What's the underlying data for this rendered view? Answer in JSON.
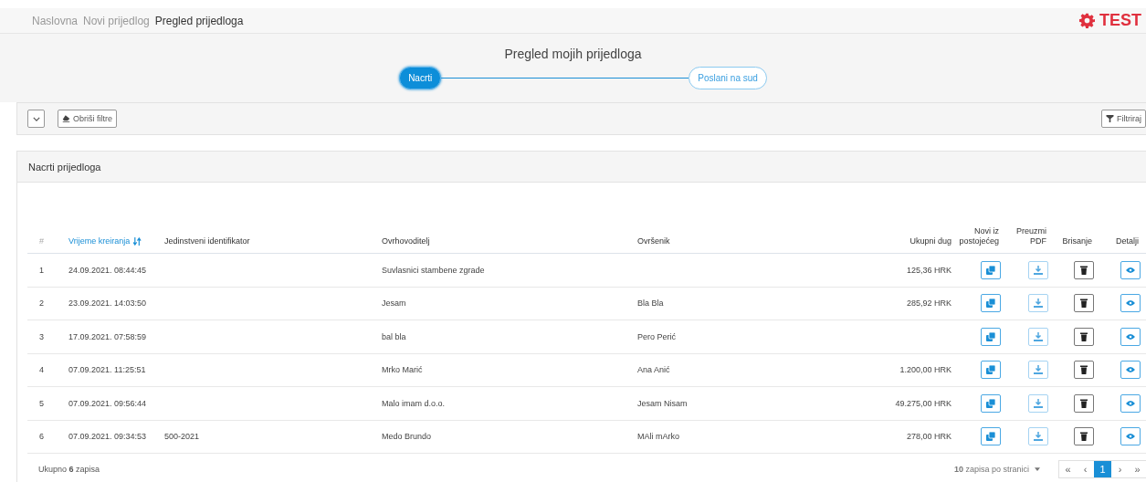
{
  "breadcrumbs": [
    {
      "label": "Naslovna",
      "selected": false
    },
    {
      "label": "Novi prijedlog",
      "selected": false
    },
    {
      "label": "Pregled prijedloga",
      "selected": true
    }
  ],
  "env_badge": "TEST",
  "page_title": "Pregled mojih prijedloga",
  "steps": [
    {
      "label": "Nacrti",
      "selected": true
    },
    {
      "label": "Poslani na sud",
      "selected": false
    }
  ],
  "filter_bar": {
    "clear_button": "Obriši filtre",
    "filter_button": "Filtriraj"
  },
  "card_title": "Nacrti prijedloga",
  "table": {
    "columns": [
      {
        "label": "#",
        "sortable": false
      },
      {
        "label": "Vrijeme kreiranja",
        "sortable": true
      },
      {
        "label": "Jedinstveni identifikator",
        "sortable": false
      },
      {
        "label": "Ovrhovoditelj",
        "sortable": false
      },
      {
        "label": "Ovršenik",
        "sortable": false
      },
      {
        "label": "Ukupni dug",
        "sortable": false
      },
      {
        "label": "Novi iz postojećeg",
        "sortable": false
      },
      {
        "label": "Preuzmi PDF",
        "sortable": false
      },
      {
        "label": "Brisanje",
        "sortable": false
      },
      {
        "label": "Detalji",
        "sortable": false
      }
    ],
    "rows": [
      {
        "num": "1",
        "created": "24.09.2021. 08:44:45",
        "identifier": "",
        "creditor": "Suvlasnici stambene zgrade",
        "debtor": "",
        "debt": "125,36 HRK"
      },
      {
        "num": "2",
        "created": "23.09.2021. 14:03:50",
        "identifier": "",
        "creditor": "Jesam",
        "debtor": "Bla Bla",
        "debt": "285,92 HRK"
      },
      {
        "num": "3",
        "created": "17.09.2021. 07:58:59",
        "identifier": "",
        "creditor": "bal bla",
        "debtor": "Pero Perić",
        "debt": ""
      },
      {
        "num": "4",
        "created": "07.09.2021. 11:25:51",
        "identifier": "",
        "creditor": "Mrko Marić",
        "debtor": "Ana Anić",
        "debt": "1.200,00 HRK"
      },
      {
        "num": "5",
        "created": "07.09.2021. 09:56:44",
        "identifier": "",
        "creditor": "Malo imam d.o.o.",
        "debtor": "Jesam Nisam",
        "debt": "49.275,00 HRK"
      },
      {
        "num": "6",
        "created": "07.09.2021. 09:34:53",
        "identifier": "500-2021",
        "creditor": "Medo Brundo",
        "debtor": "MAli mArko",
        "debt": "278,00 HRK"
      }
    ]
  },
  "footer": {
    "total": "Ukupno **6** zapisa",
    "page_size": "**10** zapisa po stranici",
    "pager": [
      {
        "label": "«",
        "selected": false
      },
      {
        "label": "‹",
        "selected": false
      },
      {
        "label": "1",
        "selected": true
      },
      {
        "label": "›",
        "selected": false
      },
      {
        "label": "»",
        "selected": false
      }
    ]
  }
}
